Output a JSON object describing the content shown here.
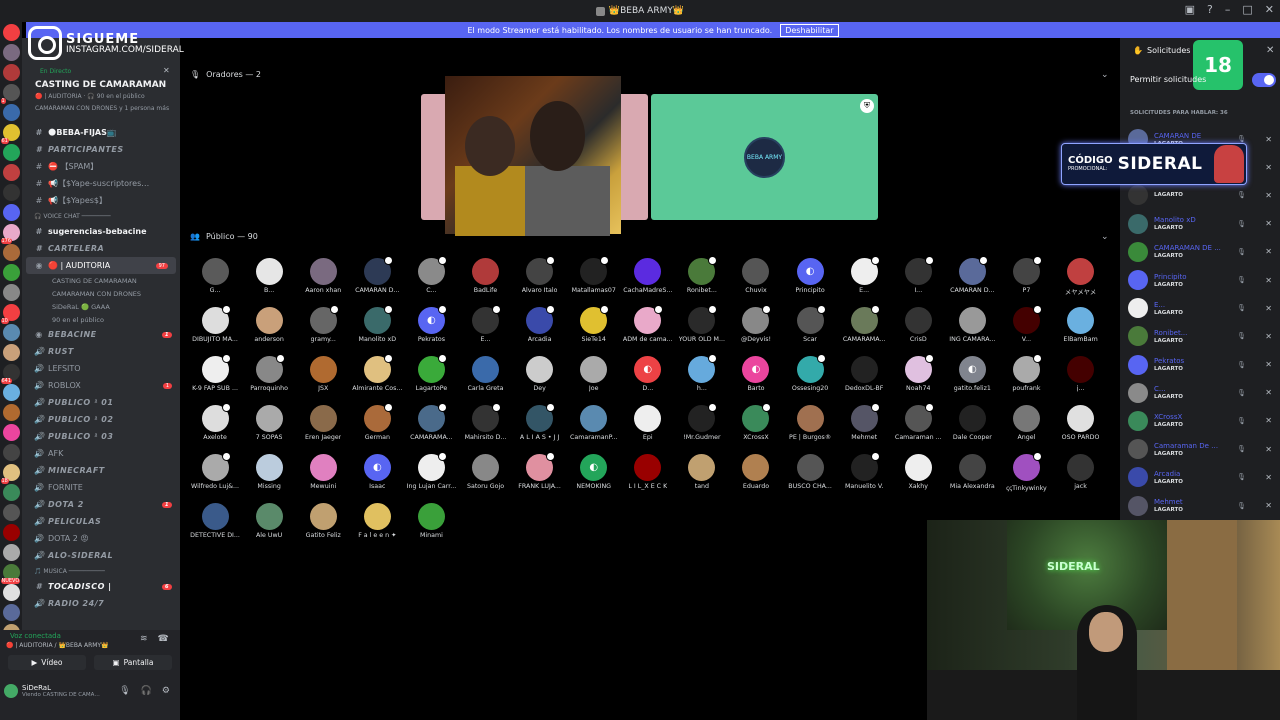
{
  "titlebar": {
    "title": "👑BEBA ARMY👑"
  },
  "banner": {
    "text": "El modo Streamer está habilitado. Los nombres de usuario se han truncado.",
    "button": "Deshabilitar"
  },
  "overlay": {
    "follow": "SIGUEME",
    "handle": "INSTAGRAM.COM/SIDERAL",
    "age": "18",
    "promo_label_1": "CÓDIGO",
    "promo_label_2": "PROMOCIONAL:",
    "promo_code": "SIDERAL",
    "cam_sign": "SIDERAL"
  },
  "event": {
    "live": "En Directo",
    "title": "CASTING DE CAMARAMAN",
    "sub1": "🔴 | AUDITORIA · 🎧 90 en el público",
    "sub2": "CAMARAMAN CON DRONES y 1 persona más"
  },
  "channels": [
    {
      "type": "text",
      "label": "🌑BEBA-FIJAS📺",
      "cls": "bold",
      "icon": "#"
    },
    {
      "type": "text",
      "label": "PARTICIPANTES",
      "cls": "it",
      "icon": "#"
    },
    {
      "type": "text",
      "label": "⛔ 【SPAM】",
      "cls": "",
      "icon": "#"
    },
    {
      "type": "text",
      "label": "📢【$Yape-suscriptores…",
      "cls": "",
      "icon": "#"
    },
    {
      "type": "text",
      "label": "📢【$Yapes$】",
      "cls": "",
      "icon": "#"
    },
    {
      "type": "cat",
      "label": "🎧 VOICE CHAT ────────",
      "cls": "cat",
      "icon": ""
    },
    {
      "type": "text",
      "label": "sugerencias-bebacine",
      "cls": "bold",
      "icon": "#"
    },
    {
      "type": "text",
      "label": "CARTELERA",
      "cls": "it",
      "icon": "#"
    },
    {
      "type": "stage",
      "label": "🔴 | AUDITORIA",
      "cls": "sel",
      "icon": "◉",
      "badge": "97"
    },
    {
      "type": "sub",
      "label": "CASTING DE CAMARAMAN",
      "cls": "sub"
    },
    {
      "type": "sub",
      "label": "CAMARAMAN CON DRONES",
      "cls": "sub"
    },
    {
      "type": "sub",
      "label": "SiDeRaL 🟢 GAAA",
      "cls": "sub"
    },
    {
      "type": "sub",
      "label": "90 en el público",
      "cls": "sub"
    },
    {
      "type": "voice",
      "label": "BEBACINE",
      "cls": "it",
      "icon": "◉",
      "badge": "1"
    },
    {
      "type": "voice",
      "label": "RUST",
      "cls": "it",
      "icon": "🔊"
    },
    {
      "type": "voice",
      "label": "LEFSITO",
      "cls": "",
      "icon": "🔊"
    },
    {
      "type": "voice",
      "label": "ROBLOX",
      "cls": "",
      "icon": "🔊",
      "badge": "1"
    },
    {
      "type": "voice",
      "label": "PUBLICO ¹ 01",
      "cls": "it",
      "icon": "🔊"
    },
    {
      "type": "voice",
      "label": "PUBLICO ¹ 02",
      "cls": "it",
      "icon": "🔊"
    },
    {
      "type": "voice",
      "label": "PUBLICO ¹ 03",
      "cls": "it",
      "icon": "🔊"
    },
    {
      "type": "voice",
      "label": "AFK",
      "cls": "",
      "icon": "🔊"
    },
    {
      "type": "voice",
      "label": "MINECRAFT",
      "cls": "it",
      "icon": "🔊"
    },
    {
      "type": "voice",
      "label": "FORNITE",
      "cls": "",
      "icon": "🔊"
    },
    {
      "type": "voice",
      "label": "DOTA 2",
      "cls": "it",
      "icon": "🔊",
      "badge": "1"
    },
    {
      "type": "voice",
      "label": "PELICULAS",
      "cls": "it",
      "icon": "🔊"
    },
    {
      "type": "voice",
      "label": "DOTA 2 😡",
      "cls": "",
      "icon": "🔊"
    },
    {
      "type": "voice",
      "label": "ALO-SIDERAL",
      "cls": "it",
      "icon": "🔊"
    },
    {
      "type": "cat",
      "label": "🎵 MUSICA ──────────",
      "cls": "cat",
      "icon": ""
    },
    {
      "type": "text",
      "label": "TOCADISCO |",
      "cls": "bold it",
      "icon": "#",
      "badge": "6"
    },
    {
      "type": "voice",
      "label": "RADIO 24/7",
      "cls": "it",
      "icon": "🔊"
    }
  ],
  "voice": {
    "connected": "Voz conectada",
    "where": "🔴 | AUDITORIA / 👑BEBA ARMY👑",
    "video": "Vídeo",
    "screen": "Pantalla"
  },
  "user": {
    "name": "SiDeRaL",
    "status": "Viendo CASTING DE CAMA…"
  },
  "stage": {
    "speakers_header": "Oradores — 2",
    "audience_header": "Público — 90",
    "speaker2_label": "BEBA ARMY"
  },
  "audience": [
    {
      "n": "G...",
      "c": "#5a5a5a",
      "d": 0
    },
    {
      "n": "B...",
      "c": "#e6e6e6",
      "d": 0
    },
    {
      "n": "Aaron xhan",
      "c": "#7a6a80",
      "d": 0
    },
    {
      "n": "CAMARAN D...",
      "c": "#2d3a55",
      "d": 1
    },
    {
      "n": "C...",
      "c": "#8a8a8a",
      "d": 1
    },
    {
      "n": "BadLife",
      "c": "#b03a3a",
      "d": 0
    },
    {
      "n": "Alvaro Italo",
      "c": "#444",
      "d": 1
    },
    {
      "n": "Matallamas07",
      "c": "#222",
      "d": 1
    },
    {
      "n": "CachaMadreS...",
      "c": "#5b2be0",
      "d": 0
    },
    {
      "n": "Ronibet...",
      "c": "#4a7a3a",
      "d": 1
    },
    {
      "n": "Chuvix",
      "c": "#555",
      "d": 0
    },
    {
      "n": "Principito",
      "c": "#5865f2",
      "d": 0,
      "dc": 1
    },
    {
      "n": "E...",
      "c": "#eee",
      "d": 1
    },
    {
      "n": "I...",
      "c": "#333",
      "d": 1
    },
    {
      "n": "CAMARAN D...",
      "c": "#5a6a9a",
      "d": 1
    },
    {
      "n": "P7",
      "c": "#444",
      "d": 1
    },
    {
      "n": "メヤメヤメ",
      "c": "#c04040",
      "d": 0
    },
    {
      "n": "DIBUJITO MA...",
      "c": "#ddd",
      "d": 1
    },
    {
      "n": "anderson",
      "c": "#c9a07a",
      "d": 0
    },
    {
      "n": "gramy...",
      "c": "#666",
      "d": 1
    },
    {
      "n": "Manolito xD",
      "c": "#3a6a6a",
      "d": 1
    },
    {
      "n": "Pekratos",
      "c": "#5865f2",
      "d": 1,
      "dc": 1
    },
    {
      "n": "E...",
      "c": "#333",
      "d": 1
    },
    {
      "n": "Arcadia",
      "c": "#3a4aaa",
      "d": 1
    },
    {
      "n": "SieTe14",
      "c": "#e0c030",
      "d": 1
    },
    {
      "n": "ADM de cama...",
      "c": "#e9a9c9",
      "d": 1
    },
    {
      "n": "YOUR OLD M...",
      "c": "#2a2a2a",
      "d": 1
    },
    {
      "n": "@Deyvis!",
      "c": "#888",
      "d": 1
    },
    {
      "n": "Scar",
      "c": "#555",
      "d": 1
    },
    {
      "n": "CAMARAMA...",
      "c": "#6a7a5a",
      "d": 1
    },
    {
      "n": "CrisD",
      "c": "#333",
      "d": 0
    },
    {
      "n": "ING CAMARA...",
      "c": "#999",
      "d": 0
    },
    {
      "n": "V...",
      "c": "#400",
      "d": 1
    },
    {
      "n": "ElBamBam",
      "c": "#6ab0e0",
      "d": 0
    },
    {
      "n": "K-9 FAP SUB ...",
      "c": "#eee",
      "d": 1
    },
    {
      "n": "Parroquinho",
      "c": "#888",
      "d": 1
    },
    {
      "n": "JSX",
      "c": "#b06a30",
      "d": 0
    },
    {
      "n": "Almirante Cos...",
      "c": "#e0c080",
      "d": 1
    },
    {
      "n": "LagartoPe",
      "c": "#3aaa3a",
      "d": 1
    },
    {
      "n": "Carla Greta",
      "c": "#3a6aaa",
      "d": 0
    },
    {
      "n": "Dey",
      "c": "#ccc",
      "d": 0
    },
    {
      "n": "Joe",
      "c": "#aaa",
      "d": 0
    },
    {
      "n": "D...",
      "c": "#ed4245",
      "d": 0,
      "dc": 1
    },
    {
      "n": "h...",
      "c": "#6ad",
      "d": 1
    },
    {
      "n": "Barto",
      "c": "#eb459e",
      "d": 0,
      "dc": 1
    },
    {
      "n": "Ossesing20",
      "c": "#3aa",
      "d": 1
    },
    {
      "n": "DedoxDL-BF",
      "c": "#222",
      "d": 0
    },
    {
      "n": "Noah74",
      "c": "#e0c0e0",
      "d": 1
    },
    {
      "n": "gatito.feliz1",
      "c": "#80848e",
      "d": 0,
      "dc": 1
    },
    {
      "n": "poufrank",
      "c": "#aaa",
      "d": 1
    },
    {
      "n": "j...",
      "c": "#400",
      "d": 0
    },
    {
      "n": "Axelote",
      "c": "#ddd",
      "d": 1
    },
    {
      "n": "7 SOPAS",
      "c": "#aaa",
      "d": 0
    },
    {
      "n": "Eren Jaeger",
      "c": "#8a6a4a",
      "d": 0
    },
    {
      "n": "German",
      "c": "#aa6a3a",
      "d": 1
    },
    {
      "n": "CAMARAMA...",
      "c": "#4a6a8a",
      "d": 1
    },
    {
      "n": "Mahirsito D...",
      "c": "#333",
      "d": 1
    },
    {
      "n": "A L I A S • J J",
      "c": "#356",
      "d": 1
    },
    {
      "n": "CamaramanP...",
      "c": "#5a8ab0",
      "d": 0
    },
    {
      "n": "Epi",
      "c": "#eee",
      "d": 0
    },
    {
      "n": "!Mr.Gudmer",
      "c": "#222",
      "d": 1
    },
    {
      "n": "XCrossX",
      "c": "#3a8a5a",
      "d": 1
    },
    {
      "n": "PE | Burgos®",
      "c": "#a07050",
      "d": 0
    },
    {
      "n": "Mehmet",
      "c": "#556",
      "d": 1
    },
    {
      "n": "Camaraman ...",
      "c": "#555",
      "d": 1
    },
    {
      "n": "Dale Cooper",
      "c": "#222",
      "d": 0
    },
    {
      "n": "Angel",
      "c": "#777",
      "d": 0
    },
    {
      "n": "OSO PARDO",
      "c": "#e0e0e0",
      "d": 0
    },
    {
      "n": "Wilfredo Luj&...",
      "c": "#aaa",
      "d": 1
    },
    {
      "n": "Missing",
      "c": "#bcd",
      "d": 0
    },
    {
      "n": "Mewuini",
      "c": "#e080c0",
      "d": 0
    },
    {
      "n": "Isaac",
      "c": "#5865f2",
      "d": 0,
      "dc": 1
    },
    {
      "n": "Ing Lujan Carr...",
      "c": "#eee",
      "d": 1
    },
    {
      "n": "Satoru Gojo",
      "c": "#888",
      "d": 0
    },
    {
      "n": "FRANK LUJA...",
      "c": "#e090a0",
      "d": 1
    },
    {
      "n": "NEMOKING",
      "c": "#23a55a",
      "d": 0,
      "dc": 1
    },
    {
      "n": "L I L_X E C K",
      "c": "#900",
      "d": 0
    },
    {
      "n": "tand",
      "c": "#c0a070",
      "d": 0
    },
    {
      "n": "Eduardo",
      "c": "#b08050",
      "d": 0
    },
    {
      "n": "BUSCO CHA...",
      "c": "#555",
      "d": 0
    },
    {
      "n": "Manuelito V.",
      "c": "#222",
      "d": 1
    },
    {
      "n": "Xakhy",
      "c": "#eee",
      "d": 0
    },
    {
      "n": "Mia Alexandra",
      "c": "#444",
      "d": 0
    },
    {
      "n": "ꞔꞔTinkywinky",
      "c": "#a050c0",
      "d": 1
    },
    {
      "n": "jack",
      "c": "#333",
      "d": 0
    },
    {
      "n": "DETECTIVE DI...",
      "c": "#3a5a8a",
      "d": 0
    },
    {
      "n": "Ale UwU",
      "c": "#5a8a6a",
      "d": 0
    },
    {
      "n": "Gatito Feliz",
      "c": "#c0a070",
      "d": 0
    },
    {
      "n": "F a l e e n ✦",
      "c": "#e0c060",
      "d": 0
    },
    {
      "n": "Minami",
      "c": "#3aa03a",
      "d": 0
    }
  ],
  "requests": {
    "title": "Solicitudes pa",
    "permit": "Permitir solicitudes",
    "permit_tail": "ne",
    "section": "SOLICITUDES PARA HABLAR: 36",
    "role": "LAGARTO",
    "items": [
      {
        "n": "CAMARAN DE",
        "c": "#5a6a9a"
      },
      {
        "n": "",
        "c": "#333"
      },
      {
        "n": "",
        "c": "#333"
      },
      {
        "n": "Manolito xD",
        "c": "#3a6a6a"
      },
      {
        "n": "CAMARAMAN DE ...",
        "c": "#3a8a3a"
      },
      {
        "n": "Principito",
        "c": "#5865f2"
      },
      {
        "n": "E...",
        "c": "#eee"
      },
      {
        "n": "Ronibet...",
        "c": "#4a7a3a"
      },
      {
        "n": "Pekratos",
        "c": "#5865f2"
      },
      {
        "n": "C...",
        "c": "#8a8a8a"
      },
      {
        "n": "XCrossX",
        "c": "#3a8a5a"
      },
      {
        "n": "Camaraman De MI ...",
        "c": "#555"
      },
      {
        "n": "Arcadia",
        "c": "#3a4aaa"
      },
      {
        "n": "Mehmet",
        "c": "#556"
      },
      {
        "n": "Alvaro Italo",
        "c": "#444"
      }
    ]
  },
  "server_icons": [
    "#f23f42",
    "#7a6a80",
    "#b03a3a",
    "#555",
    "#3a6aaa",
    "#e0c030",
    "#23a55a",
    "#c04040",
    "#333",
    "#5865f2",
    "#e9a9c9",
    "#aa6a3a",
    "#3aa03a",
    "#888",
    "#f23f42",
    "#5a8ab0",
    "#c9a07a",
    "#333",
    "#6ab0e0",
    "#b06a30",
    "#eb459e",
    "#444",
    "#e0c080",
    "#3a8a5a",
    "#555",
    "#900",
    "#aaa",
    "#4a7a3a",
    "#e0e0e0",
    "#5a6a9a",
    "#c0a070",
    "#222",
    "#e080c0",
    "#3a5a8a"
  ],
  "server_badges": {
    "3": "1",
    "5": "61",
    "10": "176",
    "14": "10",
    "17": "641",
    "22": "18",
    "27": "NUEVO"
  }
}
